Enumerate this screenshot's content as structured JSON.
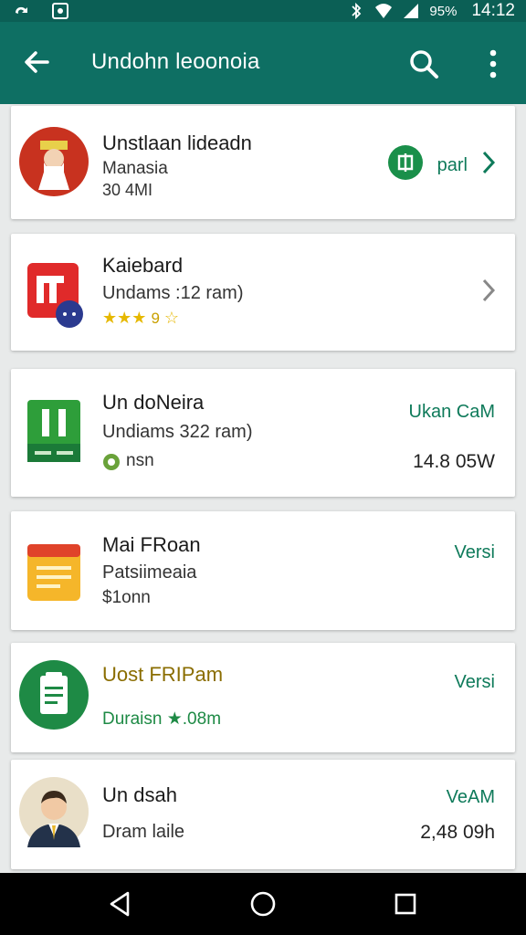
{
  "status_bar": {
    "battery": "95%",
    "time": "14:12"
  },
  "app_bar": {
    "title": "Undohn leoonoia"
  },
  "items": [
    {
      "title": "Unstlaan lideadn",
      "subtitle": "Manasia",
      "meta": "30 4MI",
      "action_label": "parl"
    },
    {
      "title": "Kaiebard",
      "subtitle": "Undams :12  ram)",
      "rating_text": "9"
    },
    {
      "title": "Un doNeira",
      "subtitle": "Undiams 322 ram)",
      "meta": "nsn",
      "right_top": "Ukan CaM",
      "right_bottom": "14.8 05W"
    },
    {
      "title": "Mai FRoan",
      "subtitle": "Patsiimeaia",
      "meta": "$1onn",
      "right_top": "Versi"
    },
    {
      "title": "Uost FRIPam",
      "meta": "Duraisn ★.08m",
      "right_top": "Versi"
    },
    {
      "title": "Un dsah",
      "subtitle": "Dram laile",
      "right_top": "VeAM",
      "right_bottom": "2,48 09h"
    }
  ],
  "colors": {
    "appbar": "#0e6f63",
    "statusbar": "#0b5f55",
    "accent": "#0e7a5a"
  }
}
